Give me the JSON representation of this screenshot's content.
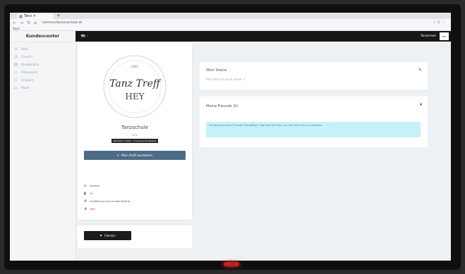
{
  "browser": {
    "tab_title": "Tanz ✕",
    "tab_add": "+",
    "url": "community.tanzschule.at",
    "bookmarks": "Apps",
    "right_icons": "☆ ⓑ ⋮"
  },
  "sidebar": {
    "brand": "Kundencenter",
    "items": [
      {
        "icon": "⌂",
        "label": "Start"
      },
      {
        "icon": "◎",
        "label": "Checkin"
      },
      {
        "icon": "▤",
        "label": "Stundenplan"
      },
      {
        "icon": "▭",
        "label": "Videoportal"
      },
      {
        "icon": "☷",
        "label": "Gruppen"
      },
      {
        "icon": "⚏",
        "label": "Musik"
      }
    ]
  },
  "topbar": {
    "menu_icon": "≡",
    "user": "Tanzschule",
    "avatar_text": "HEY"
  },
  "breadcrumb": "⌂ ›",
  "profile": {
    "logo_top": "· 2002 ·",
    "logo_line1": "Tanz Treff",
    "logo_line2": "HEY",
    "name": "Tanzschule",
    "city": "Linz",
    "tag": "Standard / Latein · Crossover Kindertanz",
    "edit_label": "Mein Profil bearbeiten",
    "contact": [
      {
        "icon": "⌂",
        "text": "Adresse",
        "red": false
      },
      {
        "icon": "▮",
        "text": "Tel.",
        "red": true
      },
      {
        "icon": "✉",
        "text": "info@tanzschule-musterstadt.at",
        "red": false
      },
      {
        "icon": "⊕",
        "text": "Web",
        "red": true
      }
    ]
  },
  "checkin": {
    "label": "Checkin"
  },
  "status": {
    "title": "Mein Status",
    "subtitle": "Hier hörst du auch online :)",
    "icon": "✎"
  },
  "friends": {
    "title": "Meine Freunde (0)",
    "icon": "▾",
    "alert": "Du hast noch keine Freunde hinzugefügt. Füge Freunde hinzu, um dich mit ihnen zu verbinden."
  }
}
